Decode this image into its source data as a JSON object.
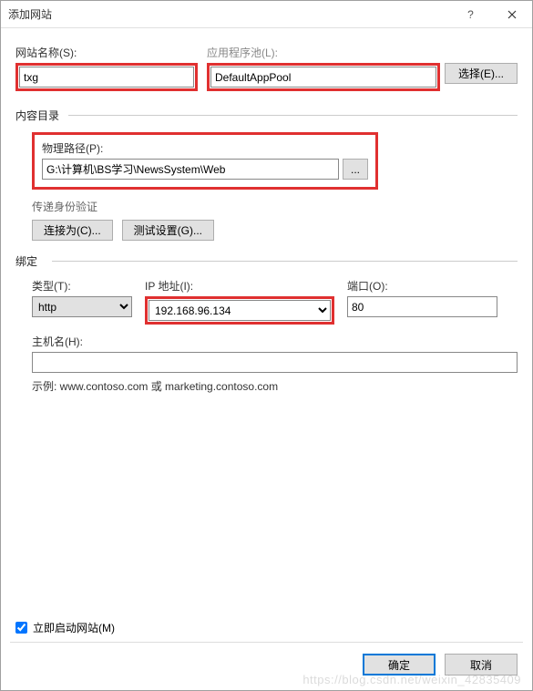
{
  "titlebar": {
    "title": "添加网站"
  },
  "siteName": {
    "label": "网站名称(S):",
    "value": "txg"
  },
  "appPool": {
    "label": "应用程序池(L):",
    "value": "DefaultAppPool",
    "selectBtn": "选择(E)..."
  },
  "contentDir": {
    "legend": "内容目录",
    "physPathLabel": "物理路径(P):",
    "physPathValue": "G:\\计算机\\BS学习\\NewsSystem\\Web",
    "browse": "...",
    "authLabel": "传递身份验证",
    "connectAs": "连接为(C)...",
    "testSettings": "测试设置(G)..."
  },
  "binding": {
    "legend": "绑定",
    "typeLabel": "类型(T):",
    "typeValue": "http",
    "ipLabel": "IP 地址(I):",
    "ipValue": "192.168.96.134",
    "portLabel": "端口(O):",
    "portValue": "80",
    "hostLabel": "主机名(H):",
    "hostValue": "",
    "example": "示例: www.contoso.com 或 marketing.contoso.com"
  },
  "startNow": {
    "label": "立即启动网站(M)"
  },
  "footer": {
    "ok": "确定",
    "cancel": "取消"
  },
  "watermark": "https://blog.csdn.net/weixin_42835409"
}
